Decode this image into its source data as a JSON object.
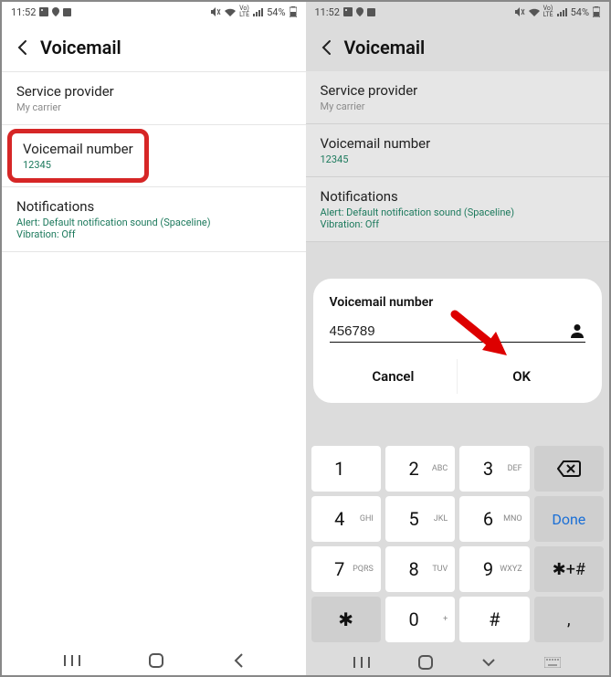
{
  "statusbar": {
    "time": "11:52",
    "battery": "54%"
  },
  "header": {
    "title": "Voicemail"
  },
  "list": {
    "service_provider": {
      "title": "Service provider",
      "sub": "My carrier"
    },
    "voicemail_number": {
      "title": "Voicemail number",
      "sub": "12345"
    },
    "notifications": {
      "title": "Notifications",
      "sub1": "Alert: Default notification sound (Spaceline)",
      "sub2": "Vibration: Off"
    }
  },
  "dialog": {
    "title": "Voicemail number",
    "value": "456789",
    "cancel": "Cancel",
    "ok": "OK"
  },
  "keypad": {
    "keys": [
      {
        "n": "1",
        "s": ""
      },
      {
        "n": "2",
        "s": "ABC"
      },
      {
        "n": "3",
        "s": "DEF"
      },
      {
        "n": "bksp"
      },
      {
        "n": "4",
        "s": "GHI"
      },
      {
        "n": "5",
        "s": "JKL"
      },
      {
        "n": "6",
        "s": "MNO"
      },
      {
        "n": "Done"
      },
      {
        "n": "7",
        "s": "PQRS"
      },
      {
        "n": "8",
        "s": "TUV"
      },
      {
        "n": "9",
        "s": "WXYZ"
      },
      {
        "n": "✱+#"
      },
      {
        "n": "✱",
        "s": "",
        "grey": true
      },
      {
        "n": "0",
        "s": "+"
      },
      {
        "n": "#",
        "s": ""
      },
      {
        "n": ",",
        "grey": true
      }
    ]
  }
}
